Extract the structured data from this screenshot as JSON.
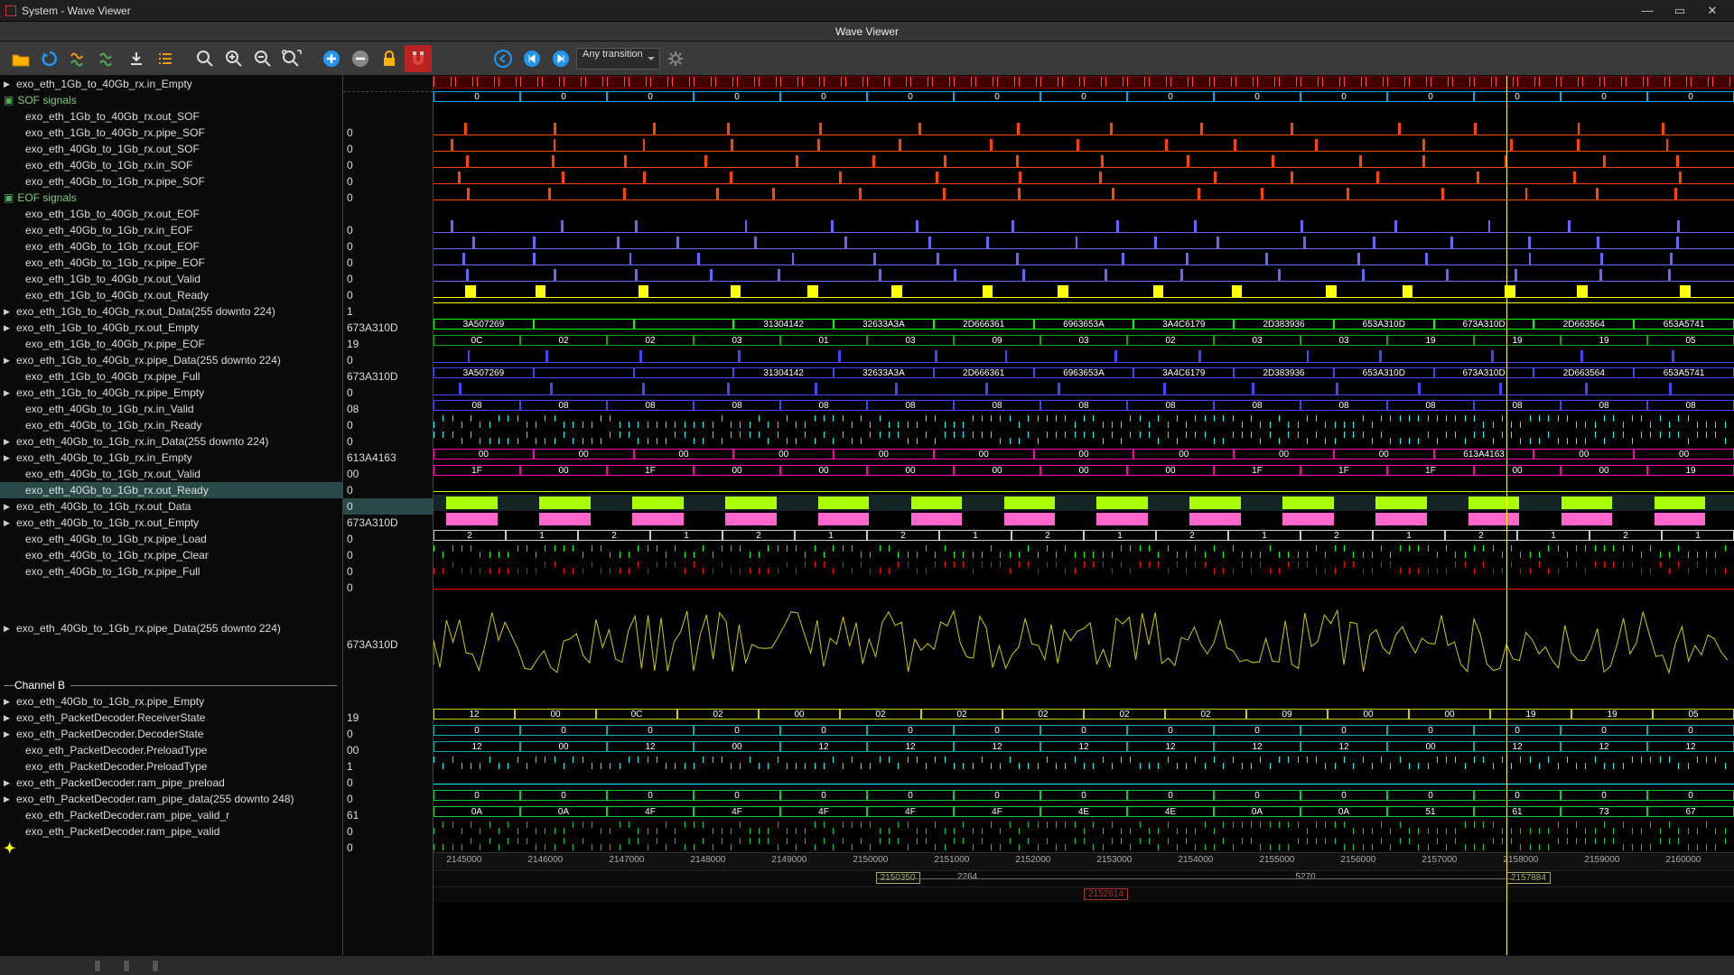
{
  "window": {
    "title": "System - Wave Viewer",
    "main_title": "Wave Viewer"
  },
  "toolbar": {
    "open": "open",
    "reload": "reload",
    "tool1": "wave-analyze",
    "tool2": "wave-edit",
    "download": "download",
    "list": "list-view",
    "zoomfit": "zoom-fit",
    "zoomin": "zoom-in",
    "zoomout": "zoom-out",
    "zoomsel": "zoom-selection",
    "add": "add",
    "remove": "remove",
    "lock": "lock",
    "magnet": "snap",
    "back": "prev-edge",
    "first": "first-edge",
    "last": "last-edge",
    "transition_label": "Any transition",
    "settings": "settings"
  },
  "signals": [
    {
      "n": "exo_eth_1Gb_to_40Gb_rx.in_Empty",
      "v": "",
      "tri": true,
      "t": "bus",
      "color": "#0af",
      "vals": [
        "0",
        "0",
        "0",
        "0",
        "0",
        "0",
        "0",
        "0",
        "0",
        "0",
        "0",
        "0",
        "0",
        "0",
        "0"
      ]
    },
    {
      "n": "SOF signals",
      "v": "",
      "group": true
    },
    {
      "n": "exo_eth_1Gb_to_40Gb_rx.out_SOF",
      "v": "0",
      "t": "pulse",
      "color": "#f40"
    },
    {
      "n": "exo_eth_1Gb_to_40Gb_rx.pipe_SOF",
      "v": "0",
      "t": "pulse",
      "color": "#f40"
    },
    {
      "n": "exo_eth_40Gb_to_1Gb_rx.out_SOF",
      "v": "0",
      "t": "pulse",
      "color": "#f40"
    },
    {
      "n": "exo_eth_40Gb_to_1Gb_rx.in_SOF",
      "v": "0",
      "t": "pulse",
      "color": "#f40"
    },
    {
      "n": "exo_eth_40Gb_to_1Gb_rx.pipe_SOF",
      "v": "0",
      "t": "pulse",
      "color": "#f40"
    },
    {
      "n": "EOF signals",
      "v": "",
      "group": true
    },
    {
      "n": "exo_eth_1Gb_to_40Gb_rx.out_EOF",
      "v": "0",
      "t": "pulse",
      "color": "#66f"
    },
    {
      "n": "exo_eth_40Gb_to_1Gb_rx.in_EOF",
      "v": "0",
      "t": "pulse",
      "color": "#66f"
    },
    {
      "n": "exo_eth_40Gb_to_1Gb_rx.out_EOF",
      "v": "0",
      "t": "pulse",
      "color": "#66f"
    },
    {
      "n": "exo_eth_40Gb_to_1Gb_rx.pipe_EOF",
      "v": "0",
      "t": "pulse",
      "color": "#66f"
    },
    {
      "n": "exo_eth_1Gb_to_40Gb_rx.out_Valid",
      "v": "0",
      "t": "pulse",
      "color": "#ff0",
      "wide": true
    },
    {
      "n": "exo_eth_1Gb_to_40Gb_rx.out_Ready",
      "v": "1",
      "t": "flat",
      "color": "#ff0"
    },
    {
      "n": "exo_eth_1Gb_to_40Gb_rx.out_Data(255 downto 224)",
      "v": "673A310D",
      "tri": true,
      "t": "bus",
      "color": "#0f0",
      "vals": [
        "3A507269",
        "",
        "",
        "31304142",
        "32633A3A",
        "2D666361",
        "6963653A",
        "3A4C6179",
        "2D383936",
        "653A310D",
        "673A310D",
        "2D663564",
        "653A5741"
      ]
    },
    {
      "n": "exo_eth_1Gb_to_40Gb_rx.out_Empty",
      "v": "19",
      "tri": true,
      "t": "bus",
      "color": "#0a0",
      "vals": [
        "0C",
        "02",
        "02",
        "03",
        "01",
        "03",
        "09",
        "03",
        "02",
        "03",
        "03",
        "19",
        "19",
        "19",
        "05"
      ]
    },
    {
      "n": "exo_eth_1Gb_to_40Gb_rx.pipe_EOF",
      "v": "0",
      "t": "pulse",
      "color": "#44f"
    },
    {
      "n": "exo_eth_1Gb_to_40Gb_rx.pipe_Data(255 downto 224)",
      "v": "673A310D",
      "tri": true,
      "t": "bus",
      "color": "#44f",
      "vals": [
        "3A507269",
        "",
        "",
        "31304142",
        "32633A3A",
        "2D666361",
        "6963653A",
        "3A4C6179",
        "2D383936",
        "653A310D",
        "673A310D",
        "2D663564",
        "653A5741"
      ]
    },
    {
      "n": "exo_eth_1Gb_to_40Gb_rx.pipe_Full",
      "v": "0",
      "t": "pulse",
      "color": "#44f"
    },
    {
      "n": "exo_eth_1Gb_to_40Gb_rx.pipe_Empty",
      "v": "08",
      "tri": true,
      "t": "bus",
      "color": "#44f",
      "vals": [
        "08",
        "08",
        "08",
        "08",
        "08",
        "08",
        "08",
        "08",
        "08",
        "08",
        "08",
        "08",
        "08",
        "08",
        "08"
      ]
    },
    {
      "n": "exo_eth_40Gb_to_1Gb_rx.in_Valid",
      "v": "0",
      "t": "dense",
      "color": "#0ff"
    },
    {
      "n": "exo_eth_40Gb_to_1Gb_rx.in_Ready",
      "v": "0",
      "t": "dense",
      "color": "#0ff"
    },
    {
      "n": "exo_eth_40Gb_to_1Gb_rx.in_Data(255 downto 224)",
      "v": "613A4163",
      "tri": true,
      "t": "densebus",
      "color": "#f0a",
      "vals": [
        "00",
        "00",
        "00",
        "00",
        "00",
        "00",
        "00",
        "00",
        "00",
        "00",
        "613A4163",
        "00",
        "00"
      ]
    },
    {
      "n": "exo_eth_40Gb_to_1Gb_rx.in_Empty",
      "v": "00",
      "tri": true,
      "t": "bus",
      "color": "#f0a",
      "vals": [
        "1F",
        "00",
        "1F",
        "00",
        "00",
        "00",
        "00",
        "00",
        "00",
        "1F",
        "1F",
        "1F",
        "00",
        "00",
        "19"
      ]
    },
    {
      "n": "exo_eth_40Gb_to_1Gb_rx.out_Valid",
      "v": "0",
      "t": "flat",
      "color": "#af0"
    },
    {
      "n": "exo_eth_40Gb_to_1Gb_rx.out_Ready",
      "v": "0",
      "sel": true,
      "t": "block",
      "color": "#af0"
    },
    {
      "n": "exo_eth_40Gb_to_1Gb_rx.out_Data",
      "v": "673A310D",
      "tri": true,
      "t": "block",
      "color": "#f6c"
    },
    {
      "n": "exo_eth_40Gb_to_1Gb_rx.out_Empty",
      "v": "0",
      "tri": true,
      "t": "bus",
      "color": "#ccc",
      "vals": [
        "2",
        "1",
        "2",
        "1",
        "2",
        "1",
        "2",
        "1",
        "2",
        "1",
        "2",
        "1",
        "2",
        "1",
        "2",
        "1",
        "2",
        "1"
      ]
    },
    {
      "n": "exo_eth_40Gb_to_1Gb_rx.pipe_Load",
      "v": "0",
      "t": "dense",
      "color": "#0f0"
    },
    {
      "n": "exo_eth_40Gb_to_1Gb_rx.pipe_Clear",
      "v": "0",
      "t": "dense",
      "color": "#f00"
    },
    {
      "n": "exo_eth_40Gb_to_1Gb_rx.pipe_Full",
      "v": "0",
      "t": "flat",
      "color": "#f00"
    },
    {
      "n": "exo_eth_40Gb_to_1Gb_rx.pipe_Data(255 downto 224)",
      "v": "673A310D",
      "tri": true,
      "t": "analog",
      "color": "#cc0",
      "rows": 6
    },
    {
      "n": "Channel B",
      "v": "",
      "divider": true
    },
    {
      "n": "exo_eth_40Gb_to_1Gb_rx.pipe_Empty",
      "v": "19",
      "tri": true,
      "t": "bus",
      "color": "#cc0",
      "vals": [
        "12",
        "00",
        "0C",
        "02",
        "00",
        "02",
        "02",
        "02",
        "02",
        "02",
        "09",
        "00",
        "00",
        "19",
        "19",
        "05"
      ]
    },
    {
      "n": "exo_eth_PacketDecoder.ReceiverState",
      "v": "0",
      "tri": true,
      "t": "bus",
      "color": "#0aa",
      "vals": [
        "0",
        "0",
        "0",
        "0",
        "0",
        "0",
        "0",
        "0",
        "0",
        "0",
        "0",
        "0",
        "0",
        "0",
        "0"
      ]
    },
    {
      "n": "exo_eth_PacketDecoder.DecoderState",
      "v": "00",
      "tri": true,
      "t": "bus",
      "color": "#0aa",
      "vals": [
        "12",
        "00",
        "12",
        "00",
        "12",
        "12",
        "12",
        "12",
        "12",
        "12",
        "12",
        "00",
        "12",
        "12",
        "12"
      ]
    },
    {
      "n": "exo_eth_PacketDecoder.PreloadType",
      "v": "1",
      "t": "dense",
      "color": "#0ff"
    },
    {
      "n": "exo_eth_PacketDecoder.PreloadType",
      "v": "0",
      "t": "flat",
      "color": "#0ff"
    },
    {
      "n": "exo_eth_PacketDecoder.ram_pipe_preload",
      "v": "0",
      "tri": true,
      "t": "bus",
      "color": "#0c4",
      "vals": [
        "0",
        "0",
        "0",
        "0",
        "0",
        "0",
        "0",
        "0",
        "0",
        "0",
        "0",
        "0",
        "0",
        "0",
        "0"
      ]
    },
    {
      "n": "exo_eth_PacketDecoder.ram_pipe_data(255 downto 248)",
      "v": "61",
      "tri": true,
      "t": "densebus",
      "color": "#0c4",
      "vals": [
        "0A",
        "0A",
        "4F",
        "4F",
        "4F",
        "4F",
        "4F",
        "4E",
        "4E",
        "0A",
        "0A",
        "51",
        "61",
        "73",
        "67"
      ]
    },
    {
      "n": "exo_eth_PacketDecoder.ram_pipe_valid_r",
      "v": "0",
      "t": "dense",
      "color": "#0c4"
    },
    {
      "n": "exo_eth_PacketDecoder.ram_pipe_valid",
      "v": "0",
      "t": "dense",
      "color": "#0c4"
    }
  ],
  "timeline": {
    "ticks": [
      "2145000",
      "2146000",
      "2147000",
      "2148000",
      "2149000",
      "2150000",
      "2151000",
      "2152000",
      "2153000",
      "2154000",
      "2155000",
      "2156000",
      "2157000",
      "2158000",
      "2159000",
      "2160000"
    ],
    "cursor_pos": 0.825,
    "marks": [
      {
        "label": "2150350",
        "color": "#aa6",
        "pos": 0.34
      },
      {
        "label": "2264",
        "color": "#888",
        "pos": 0.4,
        "plain": true
      },
      {
        "label": "2152614",
        "color": "#a33",
        "pos": 0.5,
        "below": true
      },
      {
        "label": "5270",
        "color": "#888",
        "pos": 0.66,
        "plain": true
      },
      {
        "label": "2157884",
        "color": "#aa6",
        "pos": 0.825
      }
    ]
  }
}
